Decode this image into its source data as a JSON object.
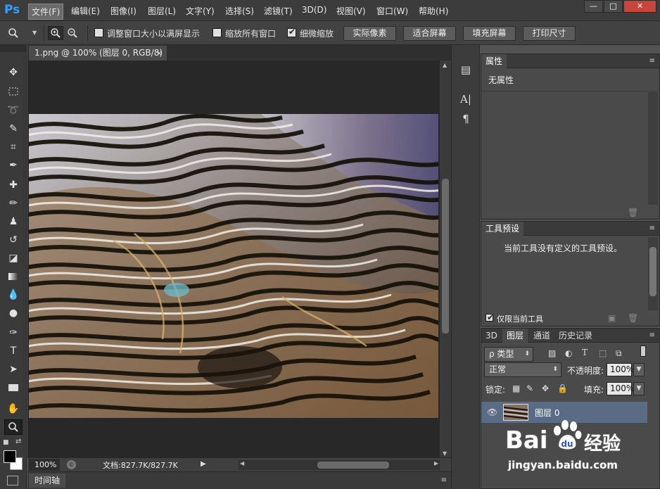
{
  "app": {
    "logo": "Ps"
  },
  "menu": [
    {
      "label": "文件(F)"
    },
    {
      "label": "编辑(E)"
    },
    {
      "label": "图像(I)"
    },
    {
      "label": "图层(L)"
    },
    {
      "label": "文字(Y)"
    },
    {
      "label": "选择(S)"
    },
    {
      "label": "滤镜(T)"
    },
    {
      "label": "3D(D)"
    },
    {
      "label": "视图(V)"
    },
    {
      "label": "窗口(W)"
    },
    {
      "label": "帮助(H)"
    }
  ],
  "window_controls": {
    "minimize": "—",
    "maximize": "□",
    "close": "✕"
  },
  "options": {
    "checkbox_resize": "调整窗口大小以满屏显示",
    "checkbox_zoom_all": "缩放所有窗口",
    "checkbox_scrubby": "细微缩放",
    "btn_actual": "实际像素",
    "btn_fit": "适合屏幕",
    "btn_fill": "填充屏幕",
    "btn_print": "打印尺寸",
    "scrubby_checked": true
  },
  "document": {
    "tab_label": "1.png @ 100% (图层 0, RGB/8)",
    "close": "×"
  },
  "status": {
    "zoom": "100%",
    "doc_info": "文档:827.7K/827.7K"
  },
  "timeline": {
    "label": "时间轴"
  },
  "properties": {
    "tab": "属性",
    "body": "无属性"
  },
  "tool_presets": {
    "tab": "工具预设",
    "body": "当前工具没有定义的工具预设。",
    "current_only": "仅限当前工具"
  },
  "layers": {
    "tabs": [
      "3D",
      "图层",
      "通道",
      "历史记录"
    ],
    "kind_filter": "ρ 类型",
    "blend_mode": "正常",
    "opacity_label": "不透明度:",
    "opacity_value": "100%",
    "lock_label": "锁定:",
    "fill_label": "填充:",
    "fill_value": "100%",
    "items": [
      {
        "name": "图层 0",
        "visible": true
      }
    ]
  },
  "watermark": {
    "brand": "Bai",
    "brand_cn": "经验",
    "url": "jingyan.baidu.com"
  },
  "colors": {
    "accent": "#2fa0ff",
    "selected_layer": "#5a6b86"
  }
}
